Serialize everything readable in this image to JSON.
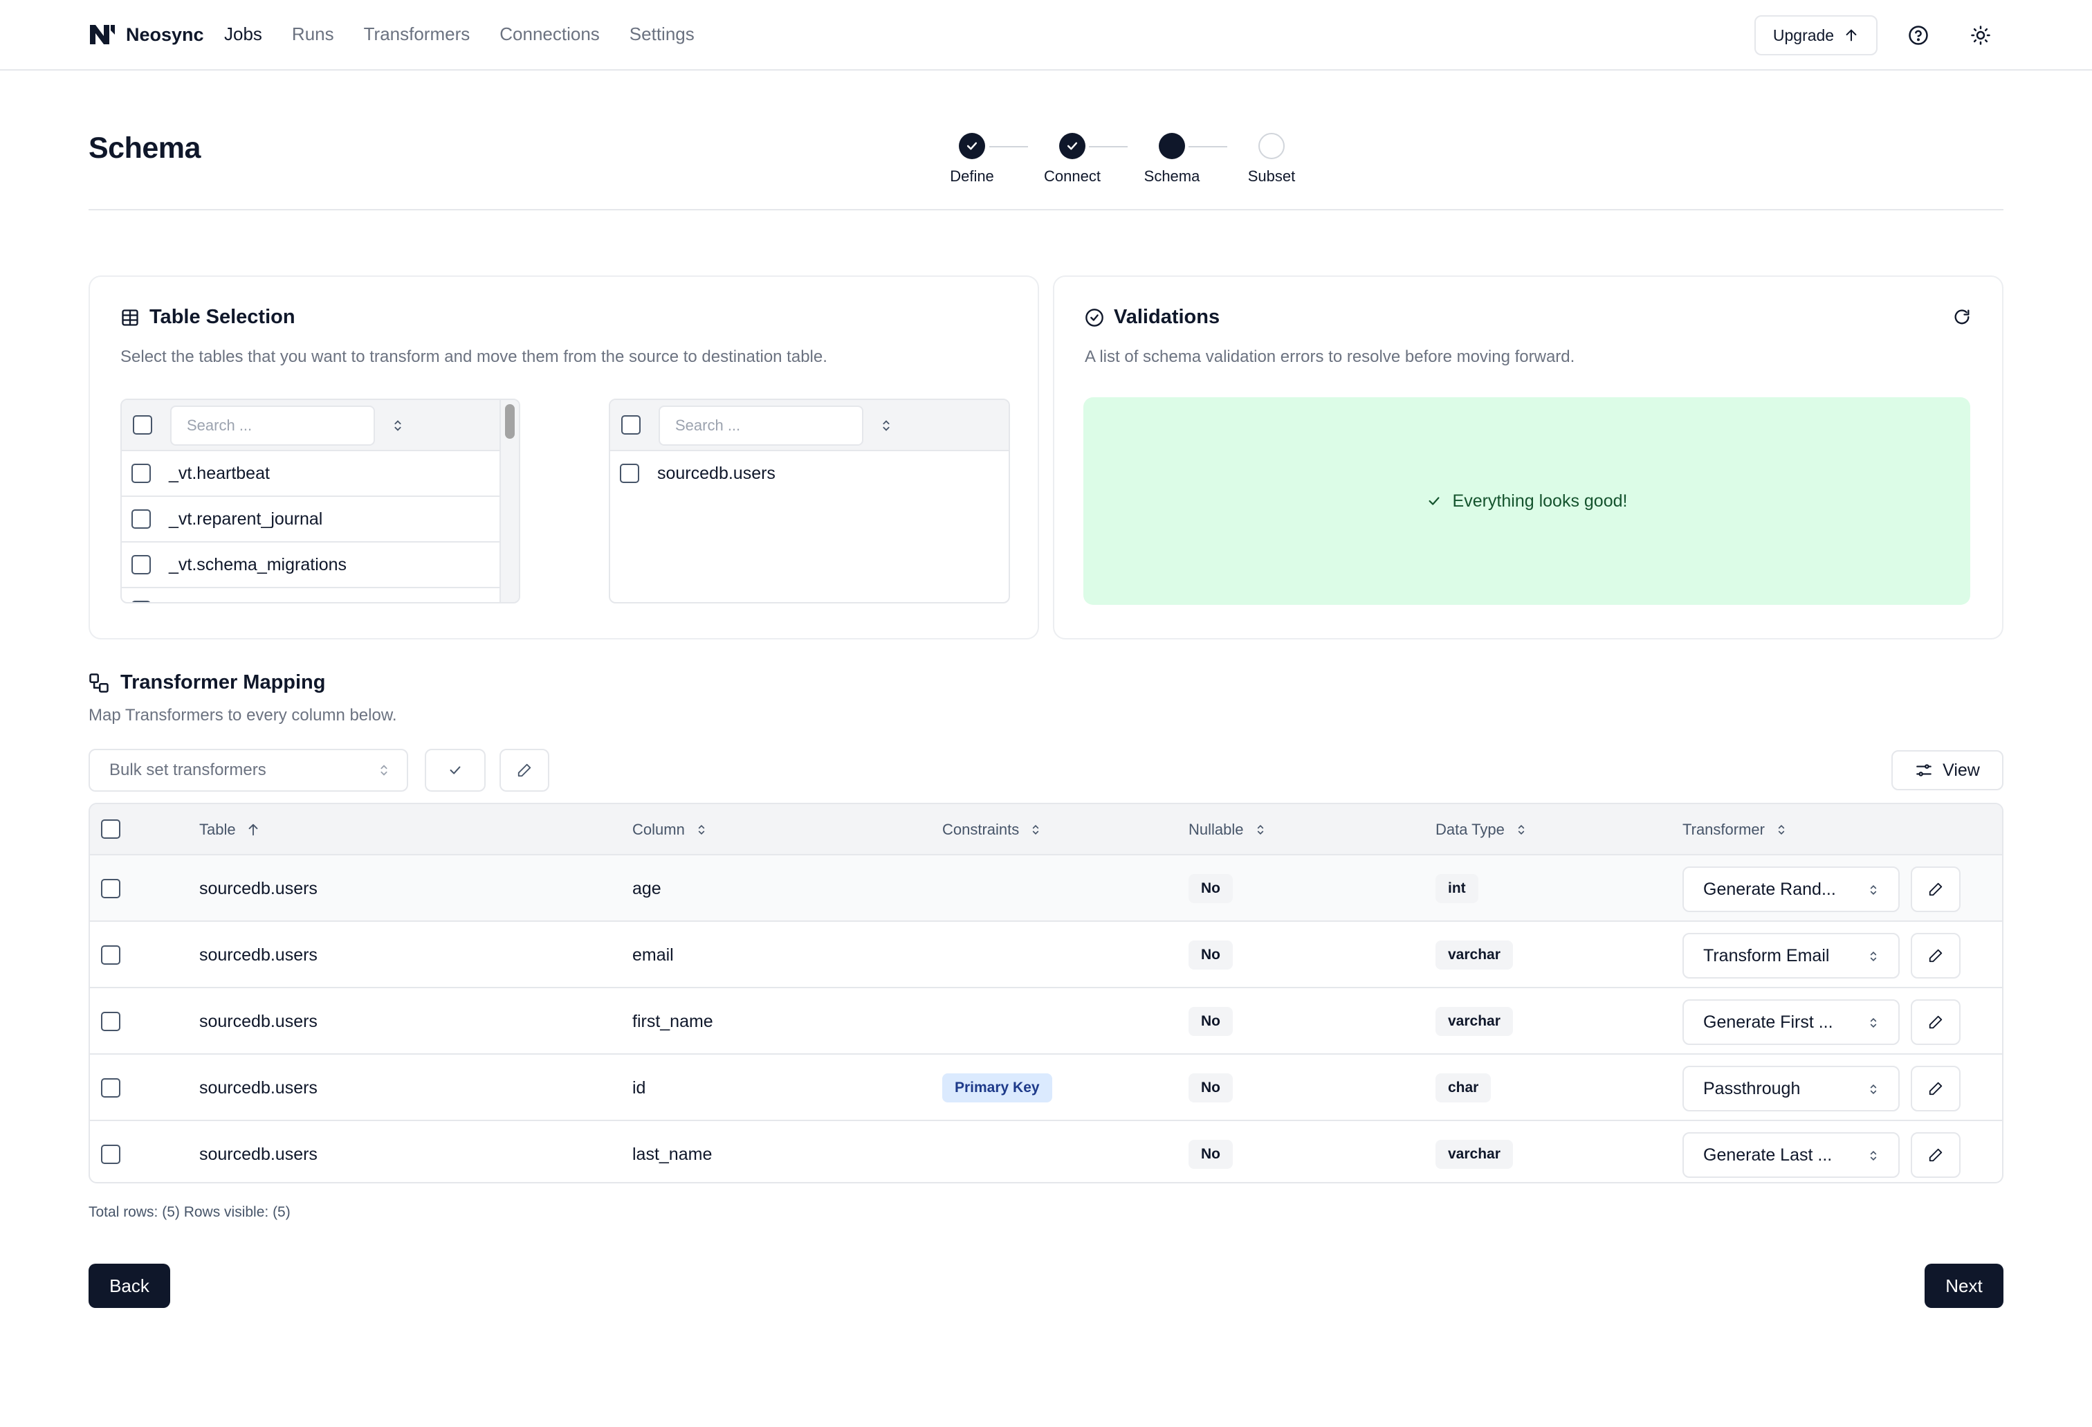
{
  "app": {
    "name": "Neosync"
  },
  "nav": {
    "items": [
      "Jobs",
      "Runs",
      "Transformers",
      "Connections",
      "Settings"
    ],
    "active": "Jobs"
  },
  "header": {
    "upgrade_label": "Upgrade"
  },
  "page": {
    "title": "Schema"
  },
  "steps": [
    {
      "label": "Define",
      "state": "done"
    },
    {
      "label": "Connect",
      "state": "done"
    },
    {
      "label": "Schema",
      "state": "current"
    },
    {
      "label": "Subset",
      "state": "todo"
    }
  ],
  "table_selection": {
    "title": "Table Selection",
    "description": "Select the tables that you want to transform and move them from the source to destination table.",
    "source": {
      "search_placeholder": "Search ...",
      "items": [
        "_vt.heartbeat",
        "_vt.reparent_journal",
        "_vt.schema_migrations"
      ]
    },
    "destination": {
      "search_placeholder": "Search ...",
      "items": [
        "sourcedb.users"
      ]
    }
  },
  "validations": {
    "title": "Validations",
    "description": "A list of schema validation errors to resolve before moving forward.",
    "status": "Everything looks good!"
  },
  "mapping": {
    "title": "Transformer Mapping",
    "description": "Map Transformers to every column below.",
    "bulk_placeholder": "Bulk set transformers",
    "view_label": "View",
    "columns": [
      "Table",
      "Column",
      "Constraints",
      "Nullable",
      "Data Type",
      "Transformer"
    ],
    "rows": [
      {
        "table": "sourcedb.users",
        "column": "age",
        "constraint": "",
        "nullable": "No",
        "data_type": "int",
        "transformer": "Generate Rand..."
      },
      {
        "table": "sourcedb.users",
        "column": "email",
        "constraint": "",
        "nullable": "No",
        "data_type": "varchar",
        "transformer": "Transform Email"
      },
      {
        "table": "sourcedb.users",
        "column": "first_name",
        "constraint": "",
        "nullable": "No",
        "data_type": "varchar",
        "transformer": "Generate First ..."
      },
      {
        "table": "sourcedb.users",
        "column": "id",
        "constraint": "Primary Key",
        "nullable": "No",
        "data_type": "char",
        "transformer": "Passthrough"
      },
      {
        "table": "sourcedb.users",
        "column": "last_name",
        "constraint": "",
        "nullable": "No",
        "data_type": "varchar",
        "transformer": "Generate Last ..."
      }
    ],
    "rows_info": "Total rows: (5) Rows visible: (5)"
  },
  "footer": {
    "back_label": "Back",
    "next_label": "Next"
  },
  "colors": {
    "primary": "#0f172a",
    "success_bg": "#dcfce7",
    "muted": "#6b7280",
    "pk_badge": "#dbeafe"
  }
}
